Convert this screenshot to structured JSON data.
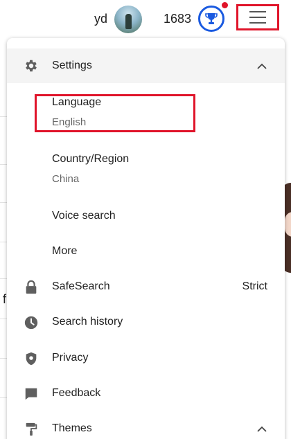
{
  "header": {
    "username": "yd",
    "points": "1683"
  },
  "menu": {
    "settings": {
      "label": "Settings"
    },
    "language": {
      "label": "Language",
      "value": "English"
    },
    "country": {
      "label": "Country/Region",
      "value": "China"
    },
    "voice_search": {
      "label": "Voice search"
    },
    "more": {
      "label": "More"
    },
    "safesearch": {
      "label": "SafeSearch",
      "value": "Strict"
    },
    "search_history": {
      "label": "Search history"
    },
    "privacy": {
      "label": "Privacy"
    },
    "feedback": {
      "label": "Feedback"
    },
    "themes": {
      "label": "Themes"
    }
  },
  "colors": {
    "accent_blue": "#1a5ae0",
    "highlight_red": "#e0142a",
    "icon_gray": "#5f5f5f"
  },
  "icons": {
    "settings": "gear-icon",
    "safesearch": "lock-icon",
    "search_history": "clock-icon",
    "privacy": "shield-icon",
    "feedback": "chat-bubble-icon",
    "themes": "paint-roller-icon",
    "rewards": "trophy-icon",
    "menu": "hamburger-icon"
  }
}
